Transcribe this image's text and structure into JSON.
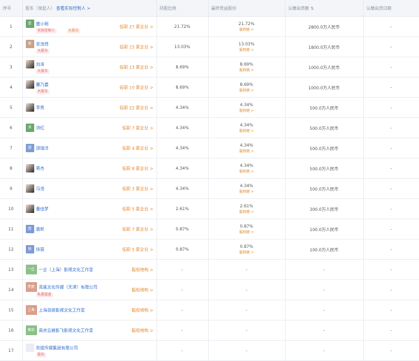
{
  "header": {
    "col_index": "序号",
    "col_name": "股东（发起人）",
    "col_name_link": "查看实际控制人 >",
    "col_ratio": "持股比例",
    "col_final": "最终受益股份",
    "col_capital": "认缴出资额",
    "col_capital_sort": "⇅",
    "col_date": "认缴出资日期"
  },
  "rows": [
    {
      "index": "1",
      "name": "雷小明",
      "avatar": "雷",
      "color": "#6aa86d",
      "tags": [
        "实际控制人",
        "大股东"
      ],
      "link": "任职 27 家企业 >",
      "ratio": "21.72%",
      "final": "21.72%",
      "final_link": "股权链 >",
      "capital": "2800.0万人民币",
      "date": "-"
    },
    {
      "index": "2",
      "name": "宋浩然",
      "avatar": "宋",
      "color": "#c9a389",
      "tags": [
        "大股东"
      ],
      "link": "任职 15 家企业 >",
      "ratio": "13.03%",
      "final": "13.03%",
      "final_link": "股权链 >",
      "capital": "1800.0万人民币",
      "date": "-"
    },
    {
      "index": "3",
      "name": "刘泽",
      "avatar": "",
      "color": "photo",
      "tags": [
        "大股东"
      ],
      "link": "任职 13 家企业 >",
      "ratio": "8.69%",
      "final": "8.69%",
      "final_link": "股权链 >",
      "capital": "1000.0万人民币",
      "date": "-"
    },
    {
      "index": "4",
      "name": "曹乃晨",
      "avatar": "",
      "color": "photo",
      "tags": [
        "大股东"
      ],
      "link": "任职 10 家企业 >",
      "ratio": "8.69%",
      "final": "8.69%",
      "final_link": "股权链 >",
      "capital": "1000.0万人民币",
      "date": "-"
    },
    {
      "index": "5",
      "name": "李秀",
      "avatar": "",
      "color": "photo",
      "tags": [],
      "link": "任职 22 家企业 >",
      "ratio": "4.34%",
      "final": "4.34%",
      "final_link": "股权链 >",
      "capital": "500.0万人民币",
      "date": "-"
    },
    {
      "index": "6",
      "name": "洪红",
      "avatar": "洪",
      "color": "#6aa86d",
      "tags": [],
      "link": "任职 7 家企业 >",
      "ratio": "4.34%",
      "final": "4.34%",
      "final_link": "股权链 >",
      "capital": "500.0万人民币",
      "date": "-"
    },
    {
      "index": "7",
      "name": "邵瑞洋",
      "avatar": "邵",
      "color": "#7f9bd4",
      "tags": [],
      "link": "任职 4 家企业 >",
      "ratio": "4.34%",
      "final": "4.34%",
      "final_link": "股权链 >",
      "capital": "500.0万人民币",
      "date": "-"
    },
    {
      "index": "8",
      "name": "蒋杰",
      "avatar": "",
      "color": "photo",
      "tags": [],
      "link": "任职 8 家企业 >",
      "ratio": "4.34%",
      "final": "4.34%",
      "final_link": "股权链 >",
      "capital": "500.0万人民币",
      "date": "-"
    },
    {
      "index": "9",
      "name": "冯浩",
      "avatar": "",
      "color": "photo",
      "tags": [],
      "link": "任职 3 家企业 >",
      "ratio": "4.34%",
      "final": "4.34%",
      "final_link": "股权链 >",
      "capital": "500.0万人民币",
      "date": "-"
    },
    {
      "index": "10",
      "name": "董佳梦",
      "avatar": "",
      "color": "photo",
      "tags": [],
      "link": "任职 5 家企业 >",
      "ratio": "2.61%",
      "final": "2.61%",
      "final_link": "股权链 >",
      "capital": "300.0万人民币",
      "date": "-"
    },
    {
      "index": "11",
      "name": "唐昕",
      "avatar": "唐",
      "color": "#7f9bd4",
      "tags": [],
      "link": "任职 7 家企业 >",
      "ratio": "0.87%",
      "final": "0.87%",
      "final_link": "股权链 >",
      "capital": "100.0万人民币",
      "date": "-"
    },
    {
      "index": "12",
      "name": "徐丽",
      "avatar": "徐",
      "color": "#7f9bd4",
      "tags": [],
      "link": "任职 5 家企业 >",
      "ratio": "0.87%",
      "final": "0.87%",
      "final_link": "股权链 >",
      "capital": "100.0万人民币",
      "date": "-"
    },
    {
      "index": "13",
      "name": "一企（上海）影视文化工作室",
      "avatar": "一企",
      "color": "#8cc08a",
      "tags": [],
      "link": "股权结构 >",
      "ratio": "-",
      "final": "-",
      "final_link": "",
      "capital": "-",
      "date": "-"
    },
    {
      "index": "14",
      "name": "亮度文化传媒（天津）有限公司",
      "avatar": "亮度",
      "color": "#d9a08b",
      "tags": [
        "私募基金"
      ],
      "link": "股权结构 >",
      "ratio": "-",
      "final": "-",
      "final_link": "",
      "capital": "-",
      "date": "-"
    },
    {
      "index": "15",
      "name": "上海劲振影视文化工作室",
      "avatar": "上海",
      "color": "#d9a08b",
      "tags": [],
      "link": "股权结构 >",
      "ratio": "-",
      "final": "-",
      "final_link": "",
      "capital": "-",
      "date": "-"
    },
    {
      "index": "16",
      "name": "南京云朗影飞影视文化工作室",
      "avatar": "南京",
      "color": "#8cc08a",
      "tags": [],
      "link": "股权结构 >",
      "ratio": "-",
      "final": "-",
      "final_link": "",
      "capital": "-",
      "date": "-"
    },
    {
      "index": "17",
      "name": "欢娱传媒集团有限公司",
      "avatar": "",
      "color": "#e9edf3",
      "tags": [
        "股东"
      ],
      "link": "",
      "ratio": "-",
      "final": "-",
      "final_link": "",
      "capital": "-",
      "date": "-"
    }
  ]
}
